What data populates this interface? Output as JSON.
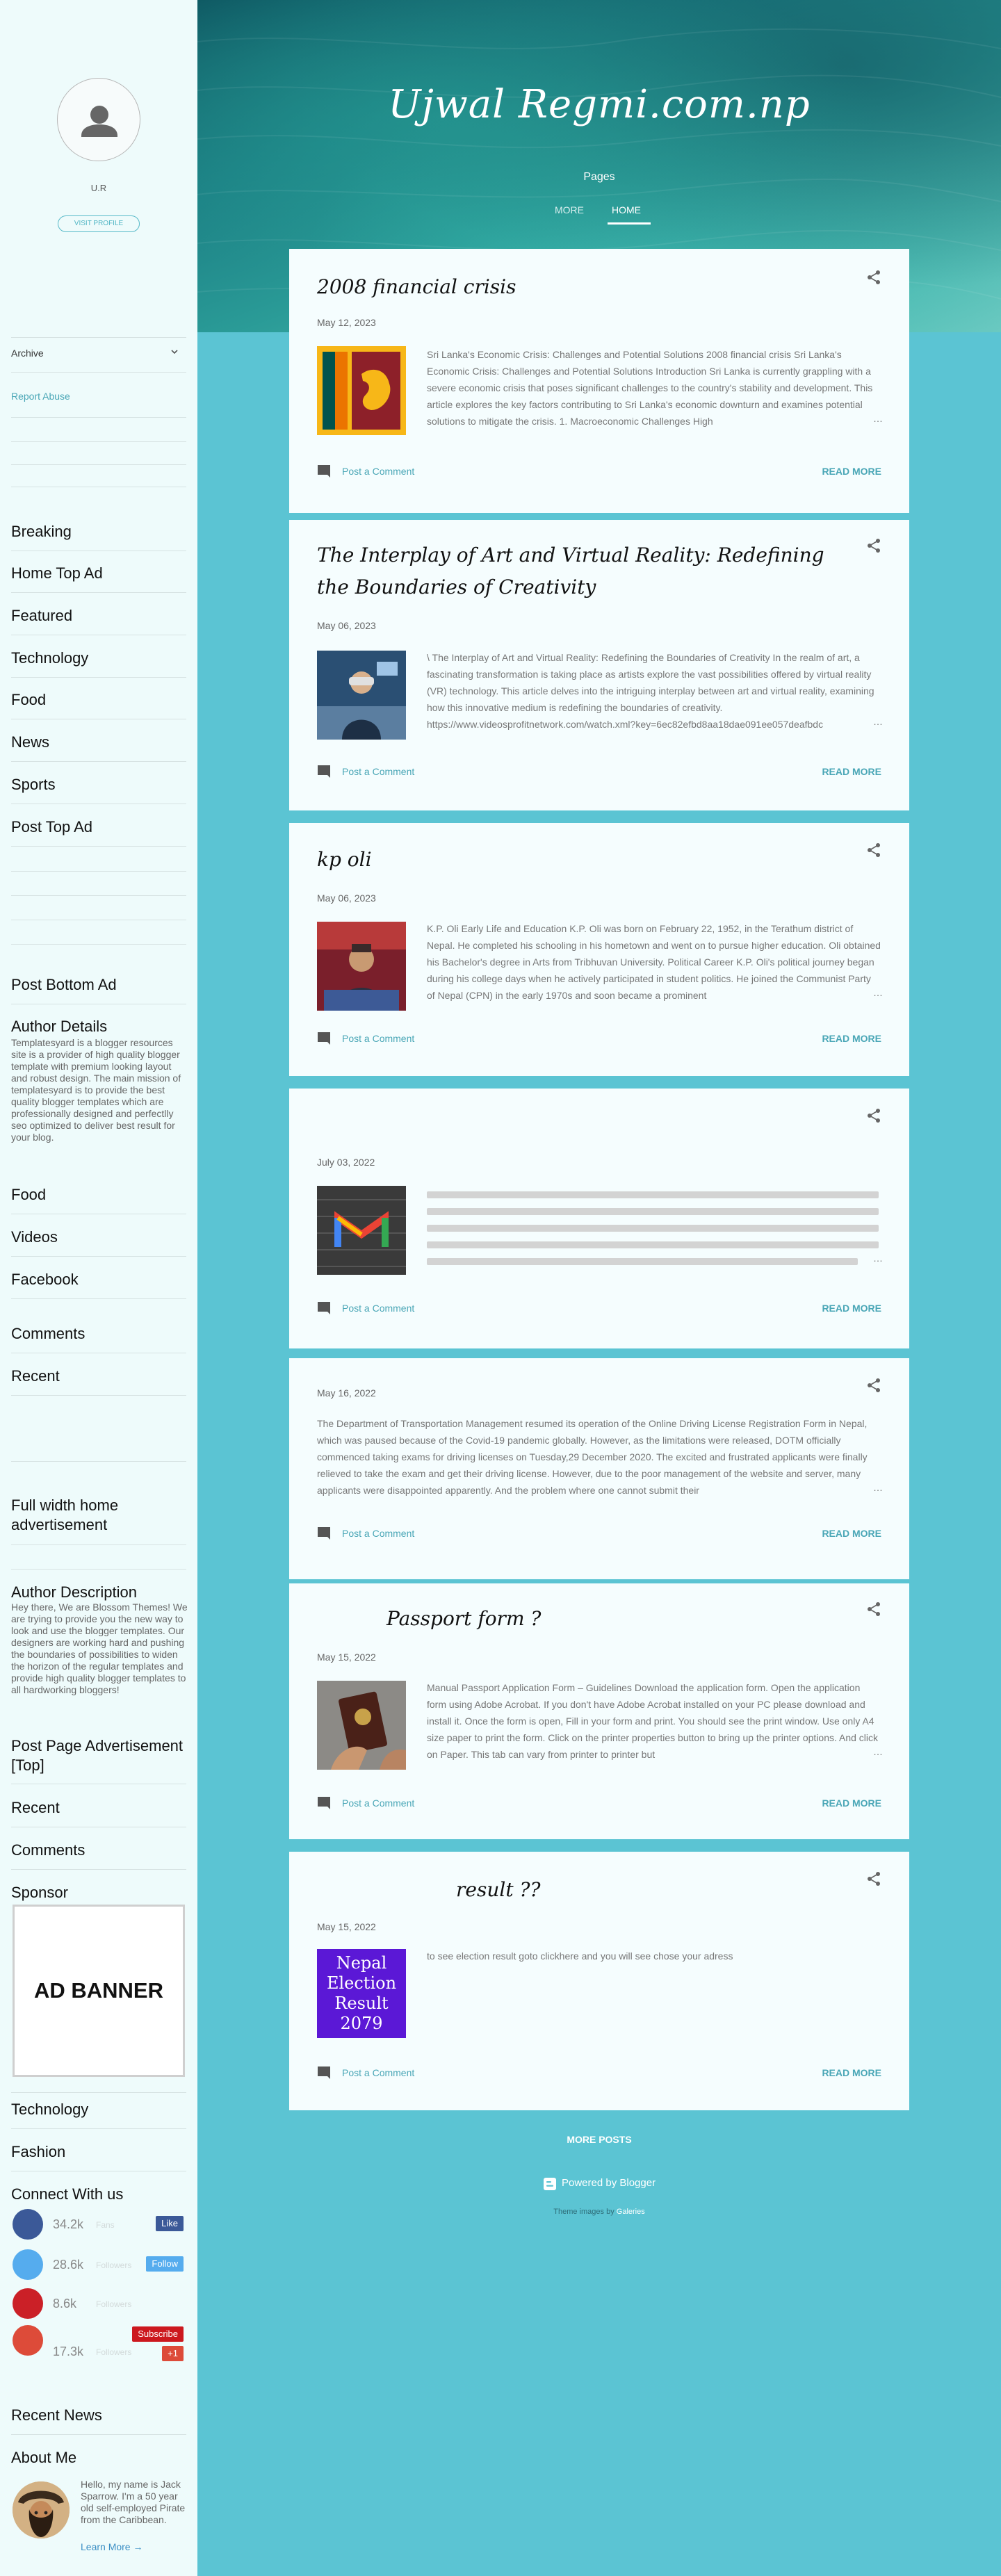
{
  "profile": {
    "name": "U.R",
    "visit_label": "VISIT PROFILE"
  },
  "sidebar": {
    "archive_label": "Archive",
    "report_abuse": "Report Abuse",
    "widgets": {
      "breaking": "Breaking",
      "home_top_ad": "Home Top Ad",
      "featured": "Featured",
      "technology": "Technology",
      "food": "Food",
      "news": "News",
      "sports": "Sports",
      "post_top_ad": "Post Top Ad",
      "post_bottom_ad": "Post Bottom Ad",
      "author_details": "Author Details",
      "author_details_text": "Templatesyard is a blogger resources site is a provider of high quality blogger template with premium looking layout and robust design. The main mission of templatesyard is to provide the best quality blogger templates which are professionally designed and perfectlly seo optimized to deliver best result for your blog.",
      "food2": "Food",
      "videos": "Videos",
      "facebook": "Facebook",
      "comments": "Comments",
      "recent": "Recent",
      "full_width": "Full width home advertisement",
      "author_description": "Author Description",
      "author_description_text": "Hey there, We are Blossom Themes! We are trying to provide you the new way to look and use the blogger templates. Our designers are working hard and pushing the boundaries of possibilities to widen the horizon of the regular templates and provide high quality blogger templates to all hardworking bloggers!",
      "post_page_ad": "Post Page Advertisement [Top]",
      "recent2": "Recent",
      "comments2": "Comments",
      "sponsor": "Sponsor",
      "ad_banner": "AD BANNER",
      "technology2": "Technology",
      "fashion": "Fashion",
      "connect": "Connect With us",
      "recent_news": "Recent News",
      "about_me": "About Me"
    },
    "connect": [
      {
        "count": "34.2k",
        "sub": "Fans",
        "button": "Like",
        "color": "#3b5998",
        "btn_color": "#3b5998"
      },
      {
        "count": "28.6k",
        "sub": "Followers",
        "button": "Follow",
        "color": "#55acee",
        "btn_color": "#55acee"
      },
      {
        "count": "8.6k",
        "sub": "Followers",
        "button": "",
        "color": "#cb2027",
        "btn_color": "#cb2027"
      },
      {
        "count": "",
        "sub": "",
        "button": "Subscribe",
        "color": "#dd4b39",
        "btn_color": "#cc181e"
      },
      {
        "count": "17.3k",
        "sub": "Followers",
        "button": "+1",
        "color": "#dd4b39",
        "btn_color": "#dd4b39"
      }
    ],
    "about_text": "Hello, my name is Jack Sparrow. I'm a 50 year old self-employed Pirate from the Caribbean.",
    "learn_more": "Learn More →"
  },
  "header": {
    "title": "Ujwal Regmi.com.np",
    "pages_title": "Pages",
    "nav_more": "MORE",
    "nav_home": "HOME"
  },
  "posts": [
    {
      "title": "2008 financial crisis",
      "date": "May 12, 2023",
      "snippet": "Sri Lanka's Economic Crisis: Challenges and Potential Solutions 2008 financial crisis Sri Lanka's Economic Crisis: Challenges and Potential Solutions Introduction Sri Lanka is currently grappling with a severe economic crisis that poses significant challenges to the country's stability and development. This article explores the key factors contributing to Sri Lanka's economic downturn and examines potential solutions to mitigate the crisis. 1. Macroeconomic Challenges High",
      "comment": "Post a Comment",
      "read_more": "READ MORE"
    },
    {
      "title": "The Interplay of Art and Virtual Reality: Redefining the Boundaries of Creativity",
      "date": "May 06, 2023",
      "snippet": "\\ The Interplay of Art and Virtual Reality: Redefining the Boundaries of Creativity In the realm of art, a fascinating transformation is taking place as artists explore the vast possibilities offered by virtual reality (VR) technology. This article delves into the intriguing interplay between art and virtual reality, examining how this innovative medium is redefining the boundaries of creativity. https://www.videosprofitnetwork.com/watch.xml?key=6ec82efbd8aa18dae091ee057deafbdc",
      "comment": "Post a Comment",
      "read_more": "READ MORE"
    },
    {
      "title": "kp oli",
      "date": "May 06, 2023",
      "snippet": "K.P. Oli Early Life and Education K.P. Oli was born on February 22, 1952, in the Terathum district of Nepal. He completed his schooling in his hometown and went on to pursue higher education. Oli obtained his Bachelor's degree in Arts from Tribhuvan University. Political Career K.P. Oli's political journey began during his college days when he actively participated in student politics. He joined the Communist Party of Nepal (CPN) in the early 1970s and soon became a prominent",
      "comment": "Post a Comment",
      "read_more": "READ MORE"
    },
    {
      "title": "",
      "date": "July 03, 2022",
      "snippet": "",
      "comment": "Post a Comment",
      "read_more": "READ MORE"
    },
    {
      "title": "",
      "date": "May 16, 2022",
      "snippet": "The Department of Transportation Management resumed its operation of the Online Driving License Registration Form in Nepal, which was paused because of the Covid-19 pandemic globally. However, as the limitations were released, DOTM officially commenced taking exams for driving licenses on Tuesday,29 December 2020. The excited and frustrated applicants were finally relieved to take the exam and get their driving license. However, due to the poor management of the website and server, many applicants were disappointed apparently. And the problem where one cannot submit their",
      "comment": "Post a Comment",
      "read_more": "READ MORE"
    },
    {
      "title": "Passport    form         ?",
      "date": "May 15, 2022",
      "snippet": "Manual Passport Application Form – Guidelines Download the application form. Open the application form using Adobe Acrobat. If you don't have Adobe Acrobat installed on your PC please download and install it. Once the form is open, Fill in your form and print. You should see the print window. Use only A4 size paper to print the form. Click on the printer properties button to bring up the printer options. And click on Paper. This tab can vary from printer to printer but",
      "comment": "Post a Comment",
      "read_more": "READ MORE"
    },
    {
      "title": "result          ??",
      "date": "May 15, 2022",
      "snippet": "to see election result goto clickhere and you will see chose your adress",
      "thumb_text": "Nepal Election Result 2079",
      "comment": "Post a Comment",
      "read_more": "READ MORE"
    }
  ],
  "footer": {
    "more_posts": "MORE POSTS",
    "powered_by": "Powered by Blogger",
    "theme_images_by": "Theme images by",
    "theme_credit": "Galeries"
  }
}
